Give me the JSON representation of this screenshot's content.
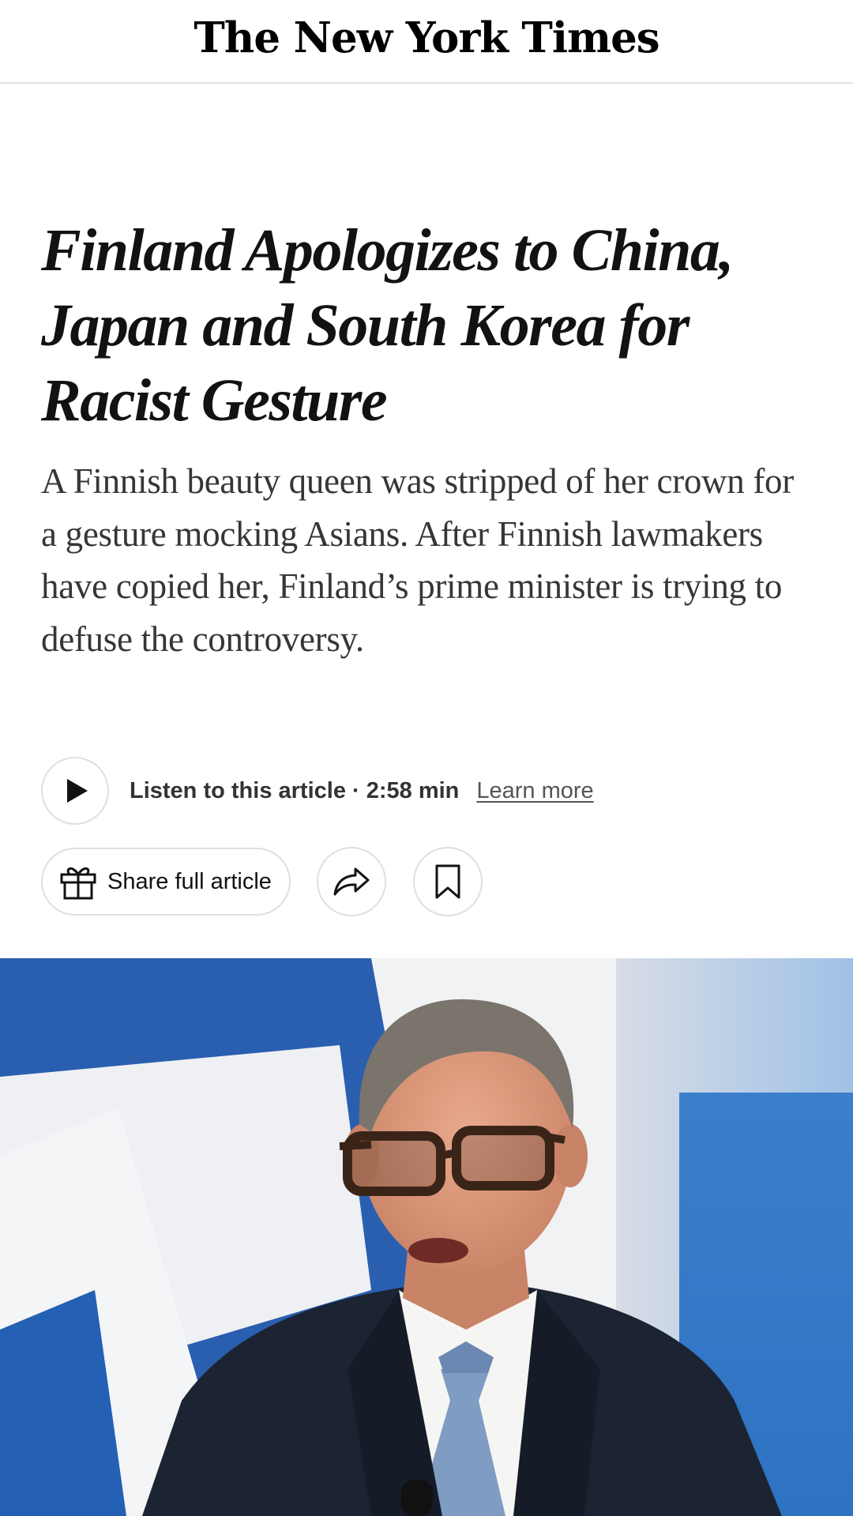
{
  "masthead": {
    "logo": "The New York Times"
  },
  "article": {
    "headline": "Finland Apologizes to China, Japan and South Korea for Racist Gesture",
    "summary": "A Finnish beauty queen was stripped of her crown for a gesture mocking Asians. After Finnish lawmakers have copied her, Finland’s prime minister is trying to defuse the controversy."
  },
  "audio": {
    "listen_label": "Listen to this article · 2:58 min",
    "learn_more": "Learn more"
  },
  "actions": {
    "share_full_label": "Share full article",
    "icons": [
      "play-icon",
      "gift-icon",
      "share-arrow-icon",
      "bookmark-icon"
    ]
  },
  "photo": {
    "subject": "man in glasses speaking in front of Finnish flag",
    "colors": {
      "flag_blue": "#1f5fae",
      "flag_white": "#f2f4f7",
      "suit": "#1c2433"
    }
  }
}
